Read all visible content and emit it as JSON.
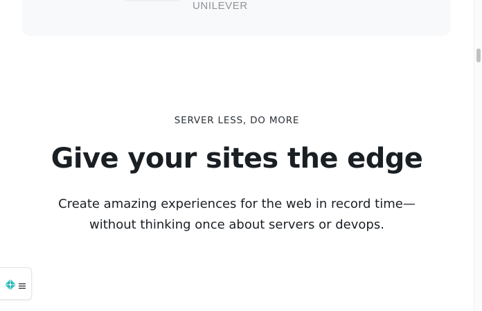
{
  "logos": {
    "visible_name": "UNILEVER"
  },
  "hero": {
    "eyebrow": "SERVER LESS, DO MORE",
    "headline": "Give your sites the edge",
    "subtext_line1": "Create amazing experiences for the web in record time—",
    "subtext_line2": "without thinking once about servers or devops."
  },
  "badge": {
    "logo_icon": "diamond-logo-icon",
    "menu_icon": "menu-icon"
  },
  "colors": {
    "text": "#1a1f24",
    "logo_card_bg": "#f8f9fa",
    "logo_text": "#8e9499",
    "brand_teal": "#30c8c9"
  }
}
